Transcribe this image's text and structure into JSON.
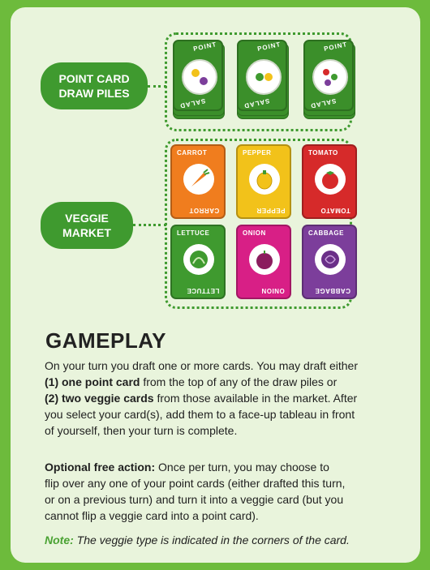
{
  "labels": {
    "point_card_draw_piles": "POINT CARD\nDRAW PILES",
    "veggie_market": "VEGGIE\nMARKET"
  },
  "point_cards": [
    {
      "top": "POINT",
      "bottom": "SALAD",
      "color": "#9b2f8f"
    },
    {
      "top": "POINT",
      "bottom": "SALAD",
      "color": "#3b8f2a"
    },
    {
      "top": "POINT",
      "bottom": "SALAD",
      "color": "#c72b2b"
    }
  ],
  "veggie_cards": [
    {
      "name": "CARROT",
      "color": "#f07d1e",
      "icon": "carrot-icon"
    },
    {
      "name": "PEPPER",
      "color": "#f2c21a",
      "icon": "pepper-icon"
    },
    {
      "name": "TOMATO",
      "color": "#d62a2a",
      "icon": "tomato-icon"
    },
    {
      "name": "LETTUCE",
      "color": "#3f9a2f",
      "icon": "lettuce-icon"
    },
    {
      "name": "ONION",
      "color": "#d81f86",
      "icon": "onion-icon"
    },
    {
      "name": "CABBAGE",
      "color": "#7c3e9b",
      "icon": "cabbage-icon"
    }
  ],
  "gameplay": {
    "title": "GAMEPLAY",
    "p1_a": "On your turn you draft one or more cards. You may draft either",
    "p1_b_bold": "(1) one point card",
    "p1_b_rest": " from the top of any of the draw piles or",
    "p1_c_bold": "(2) two veggie cards",
    "p1_c_rest": " from those available in the market. After",
    "p1_d": "you select your card(s), add them to a face-up tableau in front",
    "p1_e": "of yourself, then your turn is complete.",
    "p2_bold": "Optional free action:",
    "p2_a": " Once per turn, you may choose to",
    "p2_b": "flip over any one of your point cards (either drafted this turn,",
    "p2_c": "or on a previous turn) and turn it into a veggie card (but you",
    "p2_d": "cannot flip a veggie card into a point card).",
    "note_label": "Note:",
    "note_text": " The veggie type is indicated in the corners of the card."
  }
}
